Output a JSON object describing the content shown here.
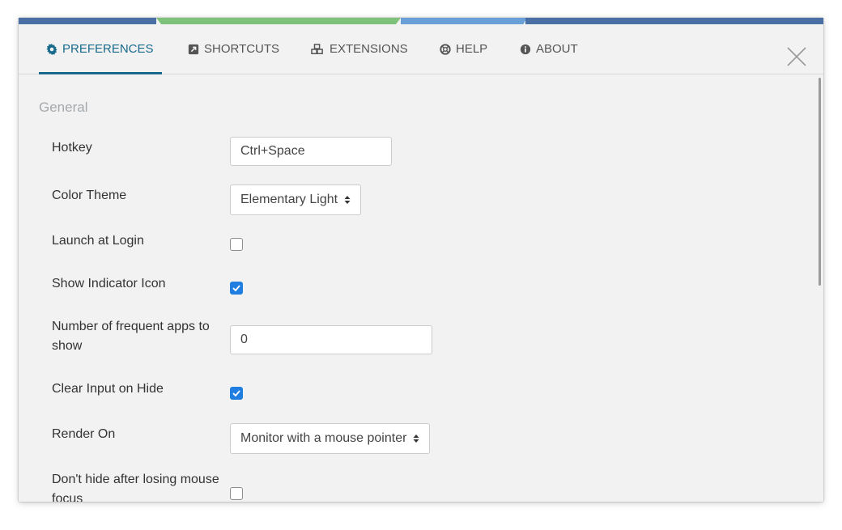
{
  "tabs": {
    "preferences": "PREFERENCES",
    "shortcuts": "SHORTCUTS",
    "extensions": "EXTENSIONS",
    "help": "HELP",
    "about": "ABOUT"
  },
  "section_title": "General",
  "settings": {
    "hotkey": {
      "label": "Hotkey",
      "value": "Ctrl+Space"
    },
    "color_theme": {
      "label": "Color Theme",
      "value": "Elementary Light"
    },
    "launch_at_login": {
      "label": "Launch at Login",
      "checked": false
    },
    "show_indicator_icon": {
      "label": "Show Indicator Icon",
      "checked": true
    },
    "frequent_apps": {
      "label": "Number of frequent apps to show",
      "value": "0"
    },
    "clear_input_on_hide": {
      "label": "Clear Input on Hide",
      "checked": true
    },
    "render_on": {
      "label": "Render On",
      "value": "Monitor with a mouse pointer"
    },
    "dont_hide": {
      "label": "Don't hide after losing mouse focus",
      "checked": false
    }
  },
  "colors": {
    "accent": "#1a6a8c",
    "checkbox_on": "#1f7ee0",
    "topbar_blue": "#4a6fa5",
    "topbar_green": "#7ec17a",
    "topbar_light_blue": "#6aa0d8"
  },
  "icons": {
    "preferences": "gear-icon",
    "shortcuts": "external-link-icon",
    "extensions": "cubes-icon",
    "help": "life-ring-icon",
    "about": "info-circle-icon",
    "close": "close-icon",
    "select": "sort-arrows-icon",
    "checkbox": "checkmark-icon"
  }
}
